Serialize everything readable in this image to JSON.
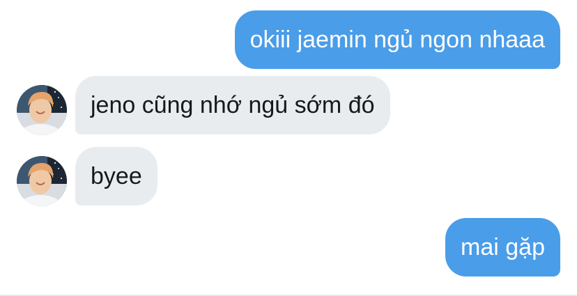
{
  "messages": [
    {
      "side": "sent",
      "text": "okiii jaemin ngủ ngon nhaaa"
    },
    {
      "side": "received",
      "text": "jeno cũng nhớ ngủ sớm đó"
    },
    {
      "side": "received",
      "text": "byee"
    },
    {
      "side": "sent",
      "text": "mai gặp"
    }
  ],
  "colors": {
    "sent_bubble": "#4a9de8",
    "received_bubble": "#e8ecef",
    "sent_text": "#ffffff",
    "received_text": "#15191c"
  },
  "icons": {
    "avatar": "profile-photo-avatar"
  }
}
